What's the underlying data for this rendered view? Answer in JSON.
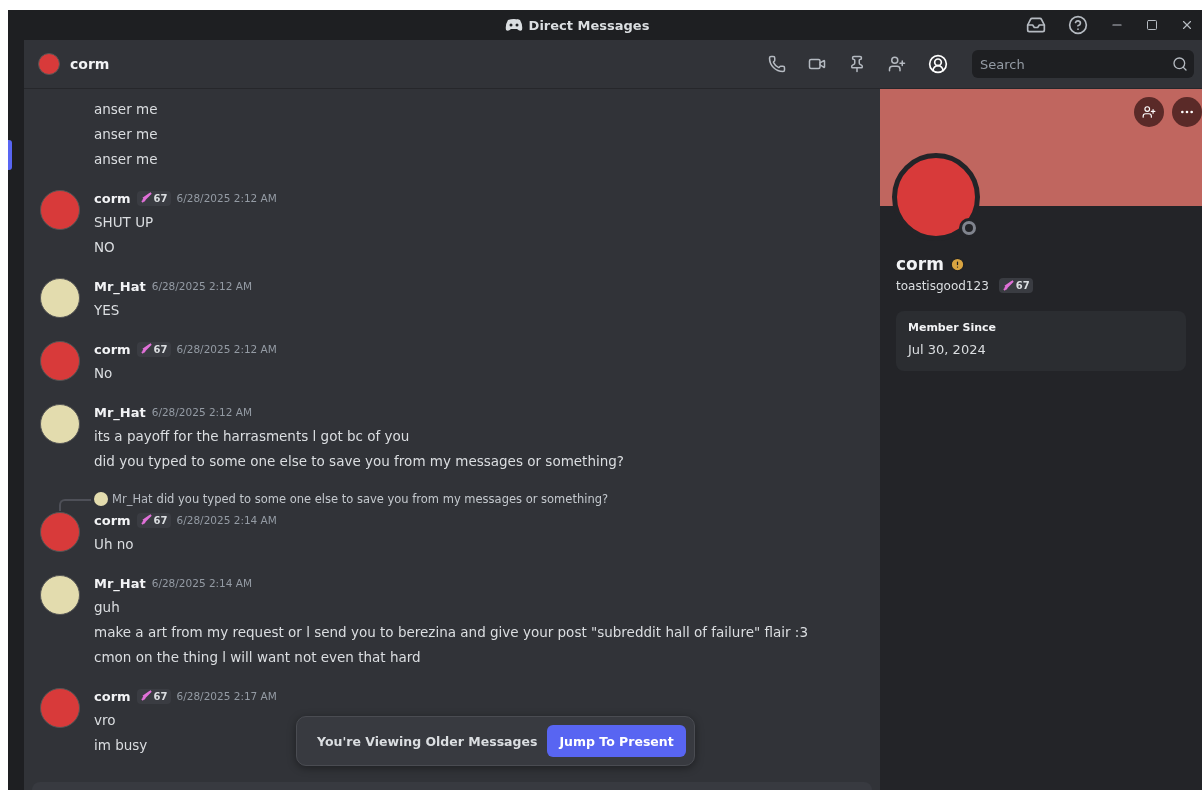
{
  "window": {
    "title": "Direct Messages"
  },
  "header": {
    "name": "corm",
    "search": {
      "placeholder": "Search"
    }
  },
  "messages": [
    {
      "kind": "continuation",
      "lines": [
        "anser me",
        "anser me",
        "anser me"
      ]
    },
    {
      "kind": "group",
      "author": "corm",
      "color": "#d83a3a",
      "tag": "67",
      "time": "6/28/2025 2:12 AM",
      "lines": [
        "SHUT UP",
        "NO"
      ]
    },
    {
      "kind": "group",
      "author": "Mr_Hat",
      "color": "#e3dcae",
      "time": "6/28/2025 2:12 AM",
      "lines": [
        "YES"
      ]
    },
    {
      "kind": "group",
      "author": "corm",
      "color": "#d83a3a",
      "tag": "67",
      "time": "6/28/2025 2:12 AM",
      "lines": [
        "No"
      ]
    },
    {
      "kind": "group",
      "author": "Mr_Hat",
      "color": "#e3dcae",
      "time": "6/28/2025 2:12 AM",
      "lines": [
        "its a payoff for the harrasments l got bc of you",
        "did you typed to some one else to save you from my messages or something?"
      ]
    },
    {
      "kind": "group",
      "author": "corm",
      "color": "#d83a3a",
      "tag": "67",
      "time": "6/28/2025 2:14 AM",
      "reply": {
        "author": "Mr_Hat",
        "color": "#e3dcae",
        "text": "did you typed to some one else to save you from my messages or something?"
      },
      "lines": [
        "Uh no"
      ]
    },
    {
      "kind": "group",
      "author": "Mr_Hat",
      "color": "#e3dcae",
      "time": "6/28/2025 2:14 AM",
      "lines": [
        "guh",
        "make a art from my request or l send you to berezina and give your post \"subreddit hall of failure\" flair :3",
        "cmon on the thing l will want not even that hard"
      ]
    },
    {
      "kind": "group",
      "author": "corm",
      "color": "#d83a3a",
      "tag": "67",
      "time": "6/28/2025 2:17 AM",
      "lines": [
        "vro",
        "im busy"
      ]
    }
  ],
  "jump_bar": {
    "text": "You're Viewing Older Messages",
    "button": "Jump To Present"
  },
  "profile": {
    "display_name": "corm",
    "username": "toastisgood123",
    "tag": "67",
    "member_since": {
      "label": "Member Since",
      "value": "Jul 30, 2024"
    }
  }
}
